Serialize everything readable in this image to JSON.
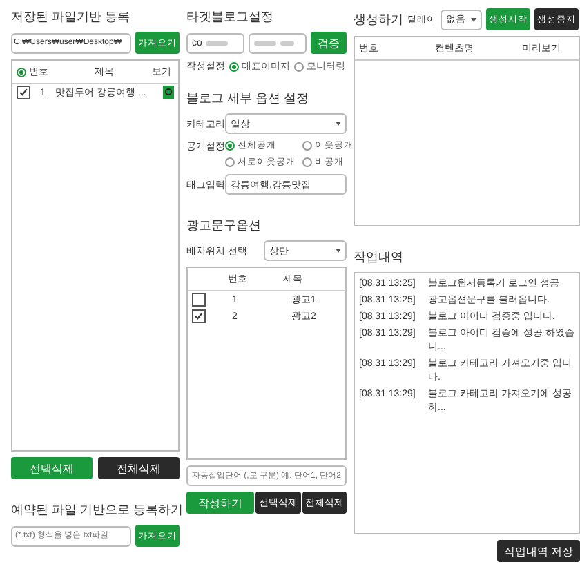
{
  "file_register": {
    "title": "저장된 파일기반 등록",
    "path": "C:₩Users₩user₩Desktop₩",
    "browse_button": "가져오기",
    "table": {
      "header_selected": true,
      "columns": [
        "번호",
        "제목",
        "보기"
      ],
      "rows": [
        {
          "checked": true,
          "number": "1",
          "title": "맛집투어 강릉여행 ..."
        }
      ]
    },
    "buttons": [
      {
        "label": "선택삭제",
        "kind": "primary"
      },
      {
        "label": "전체삭제",
        "kind": "dark"
      }
    ]
  },
  "reserved_register": {
    "title": "예약된 파일 기반으로 등록하기",
    "placeholder": "(*.txt) 형식을 넣은 txt파일",
    "browse_button": "가져오기"
  },
  "target_blog": {
    "title": "타겟블로그설정",
    "id_value": "co",
    "verify_button": "검증",
    "write_label": "작성설정",
    "write_options": [
      {
        "label": "대표이미지",
        "selected": true
      },
      {
        "label": "모니터링",
        "selected": false
      }
    ]
  },
  "detail_options": {
    "title": "블로그 세부 옵션 설정",
    "category_label": "카테고리",
    "category": "일상",
    "visibility_label": "공개설정",
    "visibility_options": [
      {
        "label": "전체공개",
        "selected": true
      },
      {
        "label": "이웃공개",
        "selected": false
      },
      {
        "label": "서로이웃공개",
        "selected": false
      },
      {
        "label": "비공개",
        "selected": false
      }
    ],
    "tag_label": "태그입력",
    "tags": "강릉여행,강릉맛집"
  },
  "ad_options": {
    "title": "광고문구옵션",
    "position_label": "배치위치 선택",
    "position": "상단",
    "columns": [
      "번호",
      "제목"
    ],
    "rows": [
      {
        "checked": false,
        "number": "1",
        "title": "광고1"
      },
      {
        "checked": true,
        "number": "2",
        "title": "광고2"
      }
    ],
    "keyword_placeholder": "자동삽입단어 (,로 구분) 예: 단어1, 단어2",
    "buttons": [
      {
        "label": "작성하기",
        "kind": "primary"
      },
      {
        "label": "선택삭제",
        "kind": "dark"
      },
      {
        "label": "전체삭제",
        "kind": "dark"
      }
    ]
  },
  "generate": {
    "title": "생성하기",
    "delay_label": "딜레이",
    "delay": "없음",
    "buttons": [
      {
        "label": "생성시작",
        "kind": "primary"
      },
      {
        "label": "생성중지",
        "kind": "dark"
      }
    ],
    "columns": [
      "번호",
      "컨텐츠명",
      "미리보기"
    ]
  },
  "work_log": {
    "title": "작업내역",
    "entries": [
      {
        "time": "[08.31 13:25]",
        "message": "블로그원서등록기 로그인 성공"
      },
      {
        "time": "[08.31 13:25]",
        "message": "광고옵션문구를 불러옵니다."
      },
      {
        "time": "[08.31 13:29]",
        "message": "블로그 아이디 검증중 입니다."
      },
      {
        "time": "[08.31 13:29]",
        "message": "블로그 아이디 검증에 성공 하였습니..."
      },
      {
        "time": "[08.31 13:29]",
        "message": "블로그 카테고리 가져오기중 입니다."
      },
      {
        "time": "[08.31 13:29]",
        "message": "블로그 카테고리 가져오기에 성공 하..."
      }
    ],
    "save_button": "작업내역 저장"
  }
}
